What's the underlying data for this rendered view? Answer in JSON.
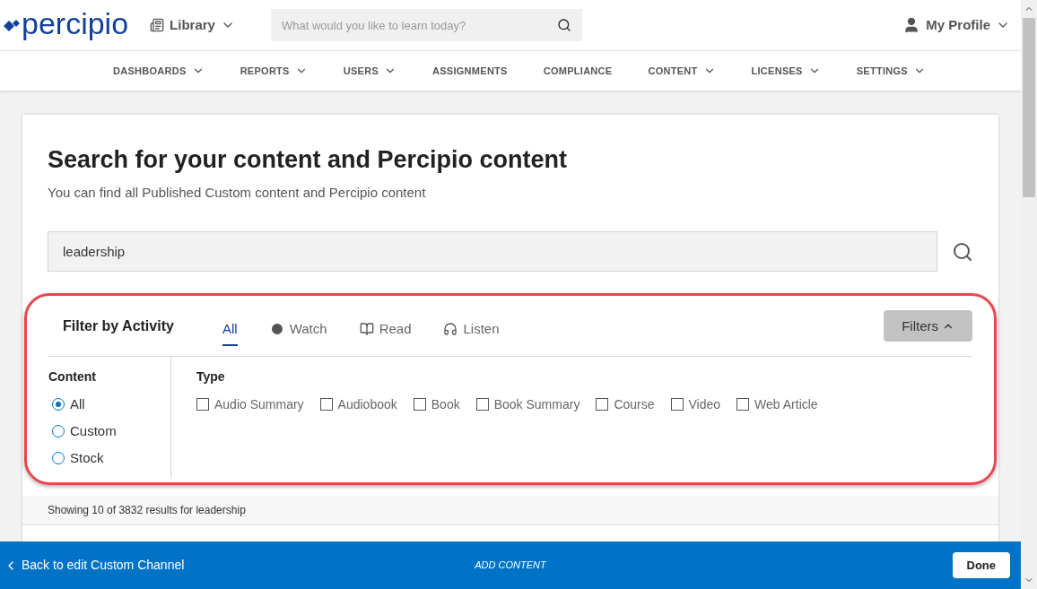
{
  "header": {
    "logo": "percipio",
    "library": "Library",
    "search": {
      "placeholder": "What would you like to learn today?"
    },
    "profile": "My Profile"
  },
  "nav": [
    {
      "label": "DASHBOARDS",
      "dropdown": true
    },
    {
      "label": "REPORTS",
      "dropdown": true
    },
    {
      "label": "USERS",
      "dropdown": true
    },
    {
      "label": "ASSIGNMENTS",
      "dropdown": false
    },
    {
      "label": "COMPLIANCE",
      "dropdown": false
    },
    {
      "label": "CONTENT",
      "dropdown": true
    },
    {
      "label": "LICENSES",
      "dropdown": true
    },
    {
      "label": "SETTINGS",
      "dropdown": true
    }
  ],
  "page": {
    "title": "Search for your content and Percipio content",
    "subtitle": "You can find all Published Custom content and Percipio content",
    "search": {
      "value": "leadership"
    }
  },
  "filters": {
    "heading": "Filter by Activity",
    "tabs": [
      {
        "label": "All",
        "kind": "all",
        "selected": true
      },
      {
        "label": "Watch",
        "kind": "watch",
        "selected": false
      },
      {
        "label": "Read",
        "kind": "read",
        "selected": false
      },
      {
        "label": "Listen",
        "kind": "listen",
        "selected": false
      }
    ],
    "toggle": "Filters",
    "expanded": true,
    "content": {
      "heading": "Content",
      "options": [
        {
          "label": "All",
          "selected": true
        },
        {
          "label": "Custom",
          "selected": false
        },
        {
          "label": "Stock",
          "selected": false
        }
      ]
    },
    "type": {
      "heading": "Type",
      "options": [
        {
          "label": "Audio Summary",
          "checked": false
        },
        {
          "label": "Audiobook",
          "checked": false
        },
        {
          "label": "Book",
          "checked": false
        },
        {
          "label": "Book Summary",
          "checked": false
        },
        {
          "label": "Course",
          "checked": false
        },
        {
          "label": "Video",
          "checked": false
        },
        {
          "label": "Web Article",
          "checked": false
        }
      ]
    }
  },
  "results": "Showing 10 of 3832 results for leadership",
  "footer": {
    "back": "Back to edit Custom Channel",
    "title": "ADD CONTENT",
    "done": "Done"
  }
}
